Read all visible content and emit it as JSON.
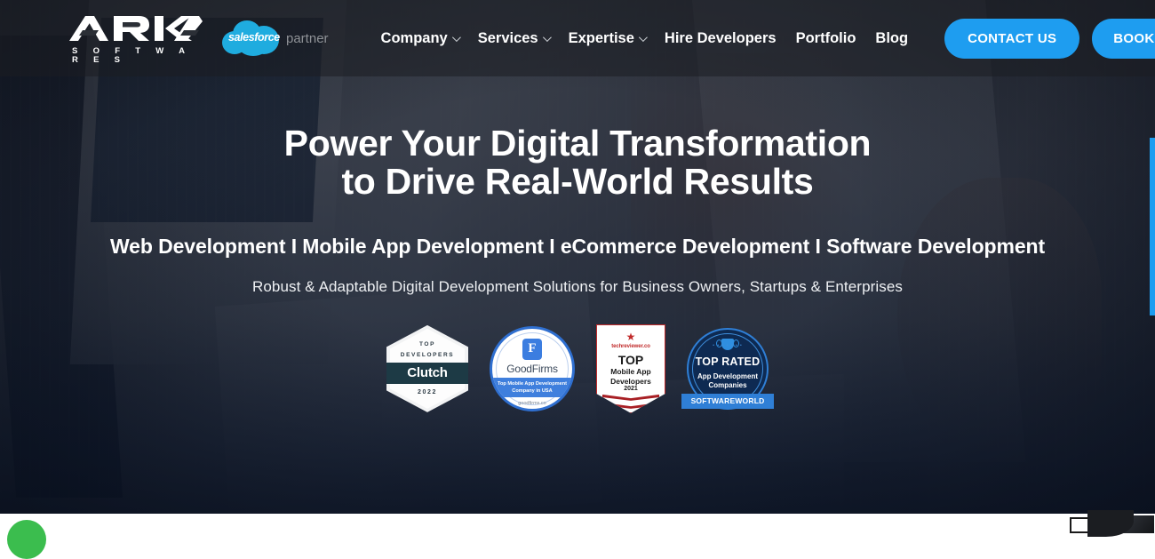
{
  "header": {
    "logo": {
      "brand": "ARKA",
      "tagline": "S O F T W A R E S",
      "mark": "arka-logo"
    },
    "partner_badge": {
      "name": "salesforce",
      "label": "partner"
    },
    "nav": [
      {
        "label": "Company",
        "has_dropdown": true
      },
      {
        "label": "Services",
        "has_dropdown": true
      },
      {
        "label": "Expertise",
        "has_dropdown": true
      },
      {
        "label": "Hire Developers",
        "has_dropdown": false
      },
      {
        "label": "Portfolio",
        "has_dropdown": false
      },
      {
        "label": "Blog",
        "has_dropdown": false
      }
    ],
    "cta_primary": "CONTACT US",
    "cta_secondary": "BOOK A CALL NOW",
    "accent_color": "#1e9df0"
  },
  "hero": {
    "headline_line1": "Power Your Digital Transformation",
    "headline_line2": "to Drive Real-World Results",
    "subheadline": "Web Development I Mobile App Development I eCommerce Development I Software Development",
    "tagline": "Robust & Adaptable Digital Development Solutions for Business Owners, Startups & Enterprises"
  },
  "badges": [
    {
      "id": "clutch",
      "top_line1": "TOP",
      "top_line2": "DEVELOPERS",
      "name": "Clutch",
      "year": "2022",
      "band_color": "#1d3a45"
    },
    {
      "id": "goodfirms",
      "logo_glyph": "F",
      "name": "GoodFirms",
      "ribbon_line1": "Top Mobile App Development",
      "ribbon_line2": "Company in USA",
      "url": "goodfirms.co",
      "accent_color": "#3f7fdd"
    },
    {
      "id": "techreviewer",
      "star": "★",
      "site": "techreviewer.co",
      "top": "TOP",
      "sub_line1": "Mobile App",
      "sub_line2": "Developers",
      "year": "2021",
      "accent_color": "#c12b2b"
    },
    {
      "id": "softwareworld",
      "dots": "• • • • • • •",
      "top": "TOP RATED",
      "sub_line1": "App Development",
      "sub_line2": "Companies",
      "banner": "SOFTWAREWORLD",
      "accent_color": "#2f7fd6"
    }
  ],
  "floating": {
    "whatsapp_label": "whatsapp-chat-button",
    "whatsapp_color": "#3bbd4e"
  },
  "scrollbar": {
    "thumb_color": "#1e9df0"
  }
}
